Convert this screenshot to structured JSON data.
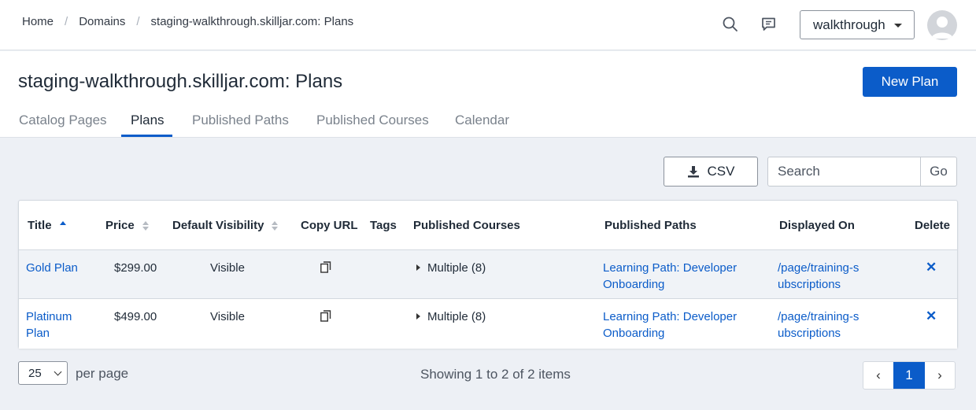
{
  "breadcrumb": [
    "Home",
    "Domains",
    "staging-walkthrough.skilljar.com: Plans"
  ],
  "workspace_select": {
    "value": "walkthrough"
  },
  "page_title": "staging-walkthrough.skilljar.com: Plans",
  "new_plan_label": "New Plan",
  "tabs": [
    {
      "label": "Catalog Pages",
      "active": false
    },
    {
      "label": "Plans",
      "active": true
    },
    {
      "label": "Published Paths",
      "active": false
    },
    {
      "label": "Published Courses",
      "active": false
    },
    {
      "label": "Calendar",
      "active": false
    }
  ],
  "toolbar": {
    "csv_label": "CSV",
    "search_placeholder": "Search",
    "go_label": "Go"
  },
  "table": {
    "columns": [
      "Title",
      "Price",
      "Default Visibility",
      "Copy URL",
      "Tags",
      "Published Courses",
      "Published Paths",
      "Displayed On",
      "Delete"
    ],
    "rows": [
      {
        "title": "Gold Plan",
        "price": "$299.00",
        "visibility": "Visible",
        "tags": "",
        "courses": "Multiple (8)",
        "paths": "Learning Path: Developer Onboarding",
        "displayed_on": "/page/training-subscriptions"
      },
      {
        "title": "Platinum Plan",
        "price": "$499.00",
        "visibility": "Visible",
        "tags": "",
        "courses": "Multiple (8)",
        "paths": "Learning Path: Developer Onboarding",
        "displayed_on": "/page/training-subscriptions"
      }
    ]
  },
  "footer": {
    "per_page_value": "25",
    "per_page_label": "per page",
    "showing": "Showing 1 to 2 of 2 items",
    "prev": "‹",
    "page": "1",
    "next": "›"
  },
  "colors": {
    "accent": "#0b5cc9",
    "background": "#edf0f5"
  }
}
